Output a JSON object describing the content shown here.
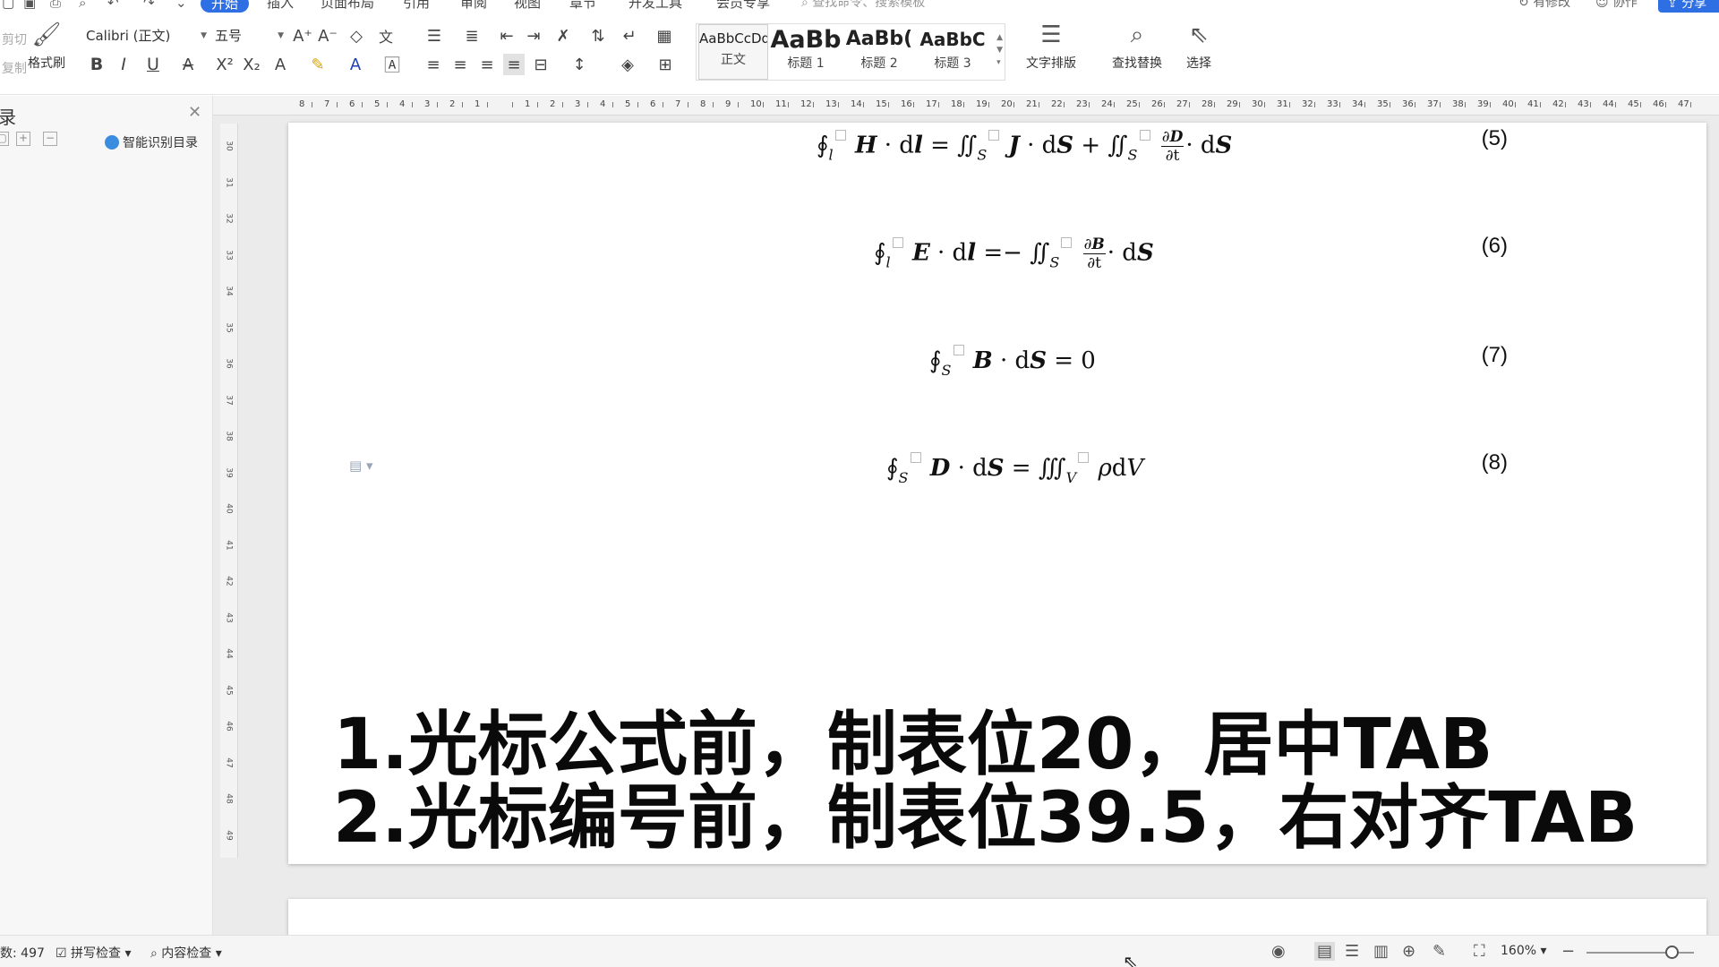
{
  "menu": {
    "tabs": [
      "开始",
      "插入",
      "页面布局",
      "引用",
      "审阅",
      "视图",
      "章节",
      "开发工具",
      "会员专享"
    ],
    "active_tab": "开始",
    "command_search_placeholder": "查找命令、搜索模板",
    "has_changes": "有修改",
    "collaborate": "协作",
    "share": "分享"
  },
  "ribbon": {
    "cut": "剪切",
    "copy": "复制",
    "format_painter": "格式刷",
    "font_name": "Calibri (正文)",
    "font_size": "五号",
    "styles": [
      {
        "preview": "AaBbCcDd",
        "name": "正文"
      },
      {
        "preview": "AaBb",
        "name": "标题 1"
      },
      {
        "preview": "AaBb(",
        "name": "标题 2"
      },
      {
        "preview": "AaBbC",
        "name": "标题 3"
      }
    ],
    "text_layout": "文字排版",
    "find_replace": "查找替换",
    "select": "选择"
  },
  "nav_pane": {
    "title": "录",
    "smart_toc": "智能识别目录"
  },
  "ruler": {
    "h_ticks": [
      "8",
      "7",
      "6",
      "5",
      "4",
      "3",
      "2",
      "1",
      "",
      "1",
      "2",
      "3",
      "4",
      "5",
      "6",
      "7",
      "8",
      "9",
      "10",
      "11",
      "12",
      "13",
      "14",
      "15",
      "16",
      "17",
      "18",
      "19",
      "20",
      "21",
      "22",
      "23",
      "24",
      "25",
      "26",
      "27",
      "28",
      "29",
      "30",
      "31",
      "32",
      "33",
      "34",
      "35",
      "36",
      "37",
      "38",
      "39",
      "40",
      "41",
      "42",
      "43",
      "44",
      "45",
      "46",
      "47"
    ],
    "v_ticks": [
      "30",
      "31",
      "32",
      "33",
      "34",
      "35",
      "36",
      "37",
      "38",
      "39",
      "40",
      "41",
      "42",
      "43",
      "44",
      "45",
      "46",
      "47",
      "48",
      "49"
    ]
  },
  "document": {
    "equations": [
      {
        "number": "(5)"
      },
      {
        "number": "(6)"
      },
      {
        "number": "(7)"
      },
      {
        "number": "(8)"
      }
    ],
    "caption_line1": "1.光标公式前，制表位20，居中TAB",
    "caption_line2": "2.光标编号前，制表位39.5，右对齐TAB"
  },
  "statusbar": {
    "word_count": "数: 497",
    "spell_check": "拼写检查",
    "content_check": "内容检查",
    "zoom": "160%"
  }
}
